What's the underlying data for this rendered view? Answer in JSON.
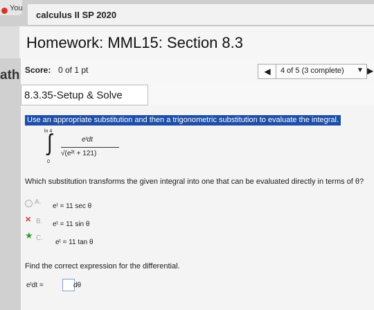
{
  "browser": {
    "tab_text": "You"
  },
  "course": {
    "title": "calculus II SP 2020"
  },
  "homework": {
    "title": "Homework: MML15: Section 8.3"
  },
  "side": {
    "text": "ath"
  },
  "score": {
    "label": "Score:",
    "value": "0 of 1 pt"
  },
  "nav": {
    "prev": "◀",
    "text": "4 of 5 (3 complete)",
    "caret": "▼",
    "next": "▶"
  },
  "section": {
    "title": "8.3.35-Setup & Solve"
  },
  "problem": {
    "instruction": "Use an appropriate substitution and then a trigonometric substitution to evaluate the integral.",
    "integral": {
      "upper": "ln 4",
      "lower": "0",
      "numerator": "eᵗdt",
      "denominator": "√(e²ᵗ + 121)"
    },
    "question": "Which substitution transforms the given integral into one that can be evaluated directly in terms of θ?",
    "options": [
      {
        "marker": "A.",
        "text": "eᵗ = 11 sec θ"
      },
      {
        "marker": "B.",
        "text": "eᵗ = 11 sin θ"
      },
      {
        "marker": "C.",
        "text": "eᵗ = 11 tan θ"
      }
    ],
    "subquestion": "Find the correct expression for the differential.",
    "diff_prefix": "eᵗdt =",
    "diff_suffix": "dθ"
  },
  "colors": {
    "highlight": "#1e4fa8",
    "wrong": "#d9322b",
    "correct": "#2f9a2f"
  }
}
